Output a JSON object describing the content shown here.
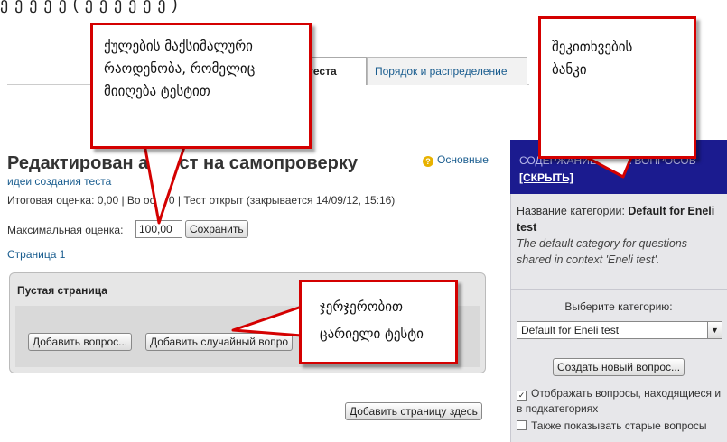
{
  "top_text_cut": "ე ე ე ე ე ( ე ე ე ე ე ე )",
  "tabs": [
    {
      "label": "теста",
      "active": true
    },
    {
      "label": "Порядок и распределение",
      "active": false
    }
  ],
  "main": {
    "title": "Редактирован а: Тест на самопроверку",
    "help_link_1": "Основные",
    "help_link_2": "идеи создания теста",
    "info": "Итоговая оценка: 0,00 | Во осы: 0 | Тест открыт (закрывается 14/09/12, 15:16)",
    "max_grade_label": "Максимальная оценка:",
    "max_grade_value": "100,00",
    "save_label": "Сохранить",
    "page_link": "Страница 1",
    "page_box_title": "Пустая страница",
    "add_question_label": "Добавить вопрос...",
    "add_random_label": "Добавить случайный вопро",
    "add_page_label": "Добавить страницу здесь"
  },
  "sidebar": {
    "head_title": "СОДЕРЖАНИЕ Б НКА ВОПРОСОВ",
    "hide_label": "[СКРЫТЬ]",
    "category_label": "Название категории:",
    "category_name": "Default for Eneli test",
    "category_desc": "The default category for questions shared in context 'Eneli test'.",
    "choose_label": "Выберите категорию:",
    "select_value": "Default for Eneli test",
    "new_question_label": "Создать новый вопрос...",
    "show_subcats_label": "Отображать вопросы, находящиеся и в подкатегориях",
    "show_subcats_checked": true,
    "show_old_label": "Также показывать старые вопросы",
    "show_old_checked": false
  },
  "callouts": {
    "c1": [
      "ქულების მაქსიმალური",
      "რაოდენობა, რომელიც",
      "მიიღება ტესტით"
    ],
    "c2": [
      "შეკითხვების",
      "ბანკი"
    ],
    "c3": [
      "ჯერჯერობით",
      "ცარიელი ტესტი"
    ]
  },
  "colors": {
    "callout_border": "#d40000",
    "link": "#1a5d8f",
    "sidebar_header": "#1b1b8f"
  }
}
